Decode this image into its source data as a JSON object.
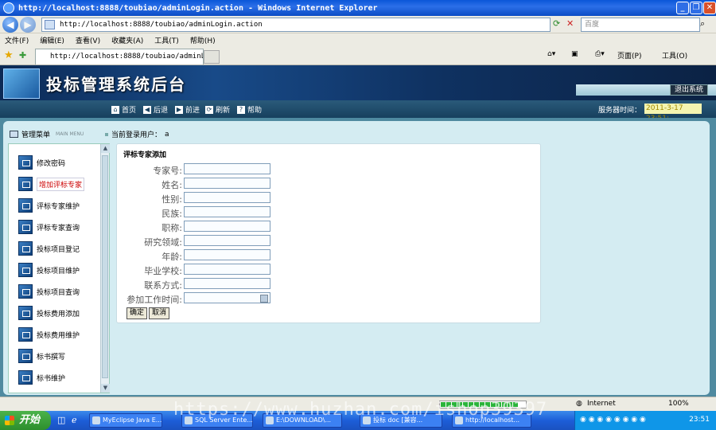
{
  "browser": {
    "title": "http://localhost:8888/toubiao/adminLogin.action - Windows Internet Explorer",
    "address": "http://localhost:8888/toubiao/adminLogin.action",
    "search_placeholder": "百度",
    "menu": [
      "文件(F)",
      "编辑(E)",
      "查看(V)",
      "收藏夹(A)",
      "工具(T)",
      "帮助(H)"
    ],
    "tab_label": "http://localhost:8888/toubiao/adminLogin....",
    "commands": {
      "page": "页面(P)",
      "tools": "工具(O)"
    },
    "status_zone": "Internet",
    "zoom": "100%"
  },
  "app": {
    "title": "投标管理系统后台",
    "logout": "退出系统",
    "nav": [
      "首页",
      "后退",
      "前进",
      "刷新",
      "帮助"
    ],
    "server_time_label": "服务器时间：",
    "server_time": "2011-3-17 23:51:"
  },
  "sidebar": {
    "header": "管理菜单",
    "header_sub": "MAIN MENU",
    "user_label": "当前登录用户：",
    "user_value": "a",
    "items": [
      {
        "label": "修改密码"
      },
      {
        "label": "增加评标专家"
      },
      {
        "label": "评标专家维护"
      },
      {
        "label": "评标专家查询"
      },
      {
        "label": "投标项目登记"
      },
      {
        "label": "投标项目维护"
      },
      {
        "label": "投标项目查询"
      },
      {
        "label": "投标费用添加"
      },
      {
        "label": "投标费用维护"
      },
      {
        "label": "标书撰写"
      },
      {
        "label": "标书维护"
      }
    ]
  },
  "form": {
    "title": "评标专家添加",
    "fields": [
      {
        "label": "专家号:",
        "value": ""
      },
      {
        "label": "姓名:",
        "value": ""
      },
      {
        "label": "性别:",
        "value": ""
      },
      {
        "label": "民族:",
        "value": ""
      },
      {
        "label": "职称:",
        "value": ""
      },
      {
        "label": "研究领域:",
        "value": ""
      },
      {
        "label": "年龄:",
        "value": ""
      },
      {
        "label": "毕业学校:",
        "value": ""
      },
      {
        "label": "联系方式:",
        "value": ""
      },
      {
        "label": "参加工作时间:",
        "value": ""
      }
    ],
    "ok": "确定",
    "cancel": "取消"
  },
  "taskbar": {
    "start": "开始",
    "tasks": [
      "MyEclipse Java E...",
      "SQL Server Ente...",
      "E:\\DOWNLOAD\\...",
      "投标 doc [兼容...",
      "http://localhost..."
    ],
    "clock": "23:51"
  },
  "watermark": "https://www.huzhan.com/ishop39397"
}
